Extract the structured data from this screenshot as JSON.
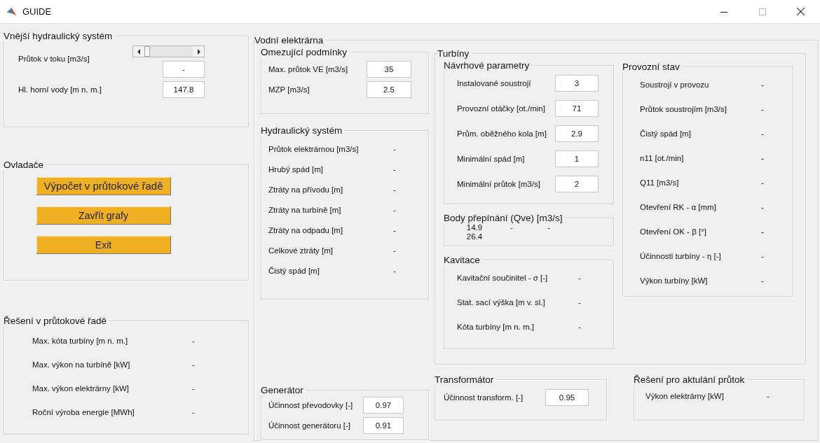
{
  "window": {
    "title": "GUIDE"
  },
  "external": {
    "title": "Vnější hydraulický systém",
    "flow_label": "Průtok v toku [m3/s]",
    "flow_slider": {
      "level": 0
    },
    "flow_value": "-",
    "level_label": "Hl. horní vody [m n. m.]",
    "level_value": "147.8"
  },
  "controls": {
    "title": "Ovladače",
    "buttons": [
      "Výpočet v průtokové řadě",
      "Zavřít grafy",
      "Exit"
    ]
  },
  "range_solution": {
    "title": "Řešení v průtokové řadě",
    "rows": [
      {
        "label": "Max. kóta turbíny [m n. m.]",
        "value": "-",
        "kind": "text"
      },
      {
        "label": "Max. výkon na turbíně [kW]",
        "value": "-",
        "kind": "text"
      },
      {
        "label": "Max. výkon elektrárny [kW]",
        "value": "-",
        "kind": "text"
      },
      {
        "label": "Roční výroba energie [MWh]",
        "value": "-",
        "kind": "text"
      }
    ]
  },
  "plant": {
    "title": "Vodní elektrárna",
    "limits": {
      "title": "Omezující podmínky",
      "rows": [
        {
          "label": "Max. průtok VE [m3/s]",
          "value": "35",
          "kind": "field"
        },
        {
          "label": "MZP [m3/s]",
          "value": "2.5",
          "kind": "field"
        }
      ]
    },
    "hydraulic": {
      "title": "Hydraulický systém",
      "rows": [
        {
          "label": "Průtok elektrárnou [m3/s]",
          "value": "-",
          "kind": "text"
        },
        {
          "label": "Hrubý spád [m]",
          "value": "-",
          "kind": "text"
        },
        {
          "label": "Ztráty na přívodu [m]",
          "value": "-",
          "kind": "text"
        },
        {
          "label": "Ztráty na turbíně  [m]",
          "value": "-",
          "kind": "text"
        },
        {
          "label": "Ztráty na odpadu [m]",
          "value": "-",
          "kind": "text"
        },
        {
          "label": "Celkové ztráty [m]",
          "value": "-",
          "kind": "text"
        },
        {
          "label": "Čistý spád [m]",
          "value": "-",
          "kind": "text"
        }
      ]
    },
    "generator": {
      "title": "Generátor",
      "rows": [
        {
          "label": "Účinnost převodovky [-]",
          "value": "0.97",
          "kind": "field"
        },
        {
          "label": "Účinnost generátoru  [-]",
          "value": "0.91",
          "kind": "field"
        }
      ]
    },
    "turbines": {
      "title": "Turbíny",
      "design": {
        "title": "Návrhové parametry",
        "rows": [
          {
            "label": "Instalované soustrojí",
            "value": "3",
            "kind": "field"
          },
          {
            "label": "Provozní otáčky [ot./min]",
            "value": "71",
            "kind": "field"
          },
          {
            "label": "Prům. oběžného kola [m]",
            "value": "2.9",
            "kind": "field"
          },
          {
            "label": "Minimální spád [m]",
            "value": "1",
            "kind": "field"
          },
          {
            "label": "Minimální průtok [m3/s]",
            "value": "2",
            "kind": "field"
          }
        ]
      },
      "switch_points": {
        "title": "Body přepínání (Qve) [m3/s]",
        "lines": [
          [
            "14.9",
            "-",
            "-"
          ],
          [
            "26.4"
          ]
        ]
      },
      "cavitation": {
        "title": "Kavitace",
        "rows": [
          {
            "label": "Kavitační součinitel - σ [-]",
            "value": "-",
            "kind": "text"
          },
          {
            "label": "Stat. sací výška [m v. sl.]",
            "value": "-",
            "kind": "text"
          },
          {
            "label": "Kóta turbíny [m n. m.]",
            "value": "-",
            "kind": "text"
          }
        ]
      },
      "operation": {
        "title": "Provozní stav",
        "rows": [
          {
            "label": "Soustrojí v provozu",
            "value": "-",
            "kind": "text"
          },
          {
            "label": "Průtok soustrojím [m3/s]",
            "value": "-",
            "kind": "text"
          },
          {
            "label": "Čistý spád [m]",
            "value": "-",
            "kind": "text"
          },
          {
            "label": "n11 [ot./min]",
            "value": "-",
            "kind": "text"
          },
          {
            "label": "Q11 [m3/s]",
            "value": "-",
            "kind": "text"
          },
          {
            "label": "Otevření RK - α [mm]",
            "value": "-",
            "kind": "text"
          },
          {
            "label": "Otevření OK - β [°]",
            "value": "-",
            "kind": "text"
          },
          {
            "label": "Účinnosti turbíny - η [-]",
            "value": "-",
            "kind": "text"
          },
          {
            "label": "Výkon turbíny [kW]",
            "value": "-",
            "kind": "text"
          }
        ]
      }
    },
    "transformer": {
      "title": "Transformátor",
      "rows": [
        {
          "label": "Účinnost transform. [-]",
          "value": "0.95",
          "kind": "field"
        }
      ]
    },
    "current_solution": {
      "title": "Řešení pro aktulání průtok",
      "rows": [
        {
          "label": "Výkon elektrárny [kW]",
          "value": "-",
          "kind": "text"
        }
      ]
    }
  }
}
